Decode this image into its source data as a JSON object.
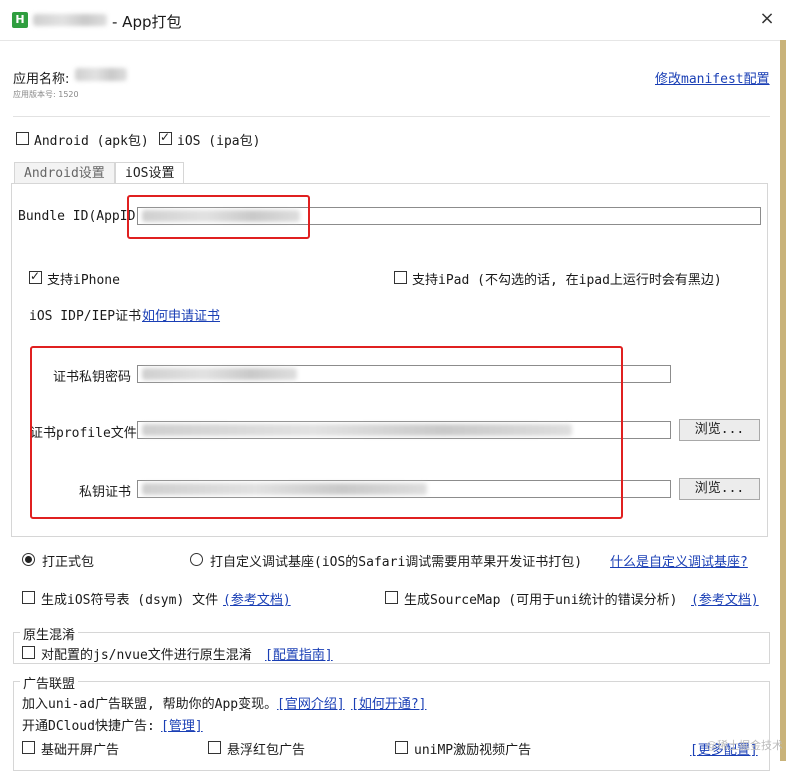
{
  "window": {
    "title": "- App打包",
    "close_label": "×"
  },
  "header": {
    "app_name_label": "应用名称:",
    "version_label": "应用版本号: 1520",
    "manifest_link": "修改manifest配置"
  },
  "platforms": {
    "android": {
      "label": "Android (apk包)",
      "checked": false
    },
    "ios": {
      "label": "iOS (ipa包)",
      "checked": true
    }
  },
  "tabs": [
    {
      "label": "Android设置",
      "active": false
    },
    {
      "label": "iOS设置",
      "active": true
    }
  ],
  "ios": {
    "bundle_id_label": "Bundle ID(AppID",
    "iphone_label": "支持iPhone",
    "iphone_checked": true,
    "ipad_label": "支持iPad (不勾选的话, 在ipad上运行时会有黑边)",
    "ipad_checked": false,
    "cert_title": "iOS IDP/IEP证书",
    "cert_link": "如何申请证书",
    "cert_password_label": "证书私钥密码",
    "profile_label": "证书profile文件",
    "private_key_label": "私钥证书",
    "browse_label": "浏览..."
  },
  "build_mode": {
    "formal_label": "打正式包",
    "custom_label": "打自定义调试基座(iOS的Safari调试需要用苹果开发证书打包)",
    "custom_link": "什么是自定义调试基座?",
    "selected": "formal"
  },
  "options": {
    "dsym_label": "生成iOS符号表 (dsym) 文件",
    "dsym_link": "(参考文档)",
    "sourcemap_label": "生成SourceMap (可用于uni统计的错误分析)",
    "sourcemap_link": "(参考文档)"
  },
  "obfuscation": {
    "title": "原生混淆",
    "option_label": "对配置的js/nvue文件进行原生混淆",
    "link": "[配置指南]"
  },
  "ads": {
    "title": "广告联盟",
    "intro_text": "加入uni-ad广告联盟, 帮助你的App变现。",
    "link_intro": "[官网介绍]",
    "link_howto": "[如何开通?]",
    "dcloud_label": "开通DCloud快捷广告:",
    "manage_link": "[管理]",
    "splash_label": "基础开屏广告",
    "redpacket_label": "悬浮红包广告",
    "rewarded_label": "uniMP激励视频广告",
    "more_link": "[更多配置]",
    "watermark": "@稀土掘金技术社区 客"
  }
}
